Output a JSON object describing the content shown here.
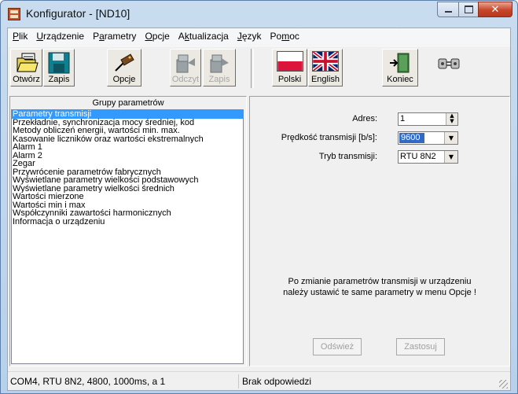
{
  "window": {
    "title": "Konfigurator - [ND10]",
    "icon": "app-icon",
    "close_color": "#c8452a"
  },
  "menubar": {
    "items": [
      {
        "label_pre": "",
        "label_key": "P",
        "label_post": "lik"
      },
      {
        "label_pre": "",
        "label_key": "U",
        "label_post": "rządzenie"
      },
      {
        "label_pre": "P",
        "label_key": "a",
        "label_post": "rametry"
      },
      {
        "label_pre": "",
        "label_key": "O",
        "label_post": "pcje"
      },
      {
        "label_pre": "A",
        "label_key": "k",
        "label_post": "tualizacja"
      },
      {
        "label_pre": "",
        "label_key": "J",
        "label_post": "ęzyk"
      },
      {
        "label_pre": "Po",
        "label_key": "m",
        "label_post": "oc"
      }
    ]
  },
  "toolbar": {
    "open": "Otwórz",
    "save": "Zapis",
    "options": "Opcje",
    "read": "Odczyt",
    "write": "Zapis",
    "polish": "Polski",
    "english": "English",
    "exit": "Koniec"
  },
  "groups": {
    "title": "Grupy parametrów",
    "selected_index": 0,
    "items": [
      "Parametry transmisji",
      "Przekładnie, synchronizacja mocy średniej, kod",
      "Metody obliczeń energii, wartości min. max.",
      "Kasowanie liczników oraz wartości ekstremalnych",
      "Alarm 1",
      "Alarm 2",
      "Zegar",
      "Przywrócenie parametrów fabrycznych",
      "Wyświetlane parametry wielkości podstawowych",
      "Wyświetlane parametry wielkości średnich",
      "Wartości mierzone",
      "Wartości min i max",
      "Współczynniki zawartości harmonicznych",
      "Informacja o urządzeniu"
    ]
  },
  "settings": {
    "address_label": "Adres:",
    "address_value": "1",
    "baud_label": "Prędkość transmisji [b/s]:",
    "baud_value": "9600",
    "mode_label": "Tryb transmisji:",
    "mode_value": "RTU 8N2",
    "info_line1": "Po zmianie parametrów transmisji w urządzeniu",
    "info_line2": "należy ustawić te same parametry w menu Opcje !",
    "refresh_button": "Odśwież",
    "apply_button": "Zastosuj"
  },
  "status": {
    "connection": "COM4, RTU 8N2, 4800, 1000ms, a 1",
    "response": "Brak odpowiedzi"
  }
}
